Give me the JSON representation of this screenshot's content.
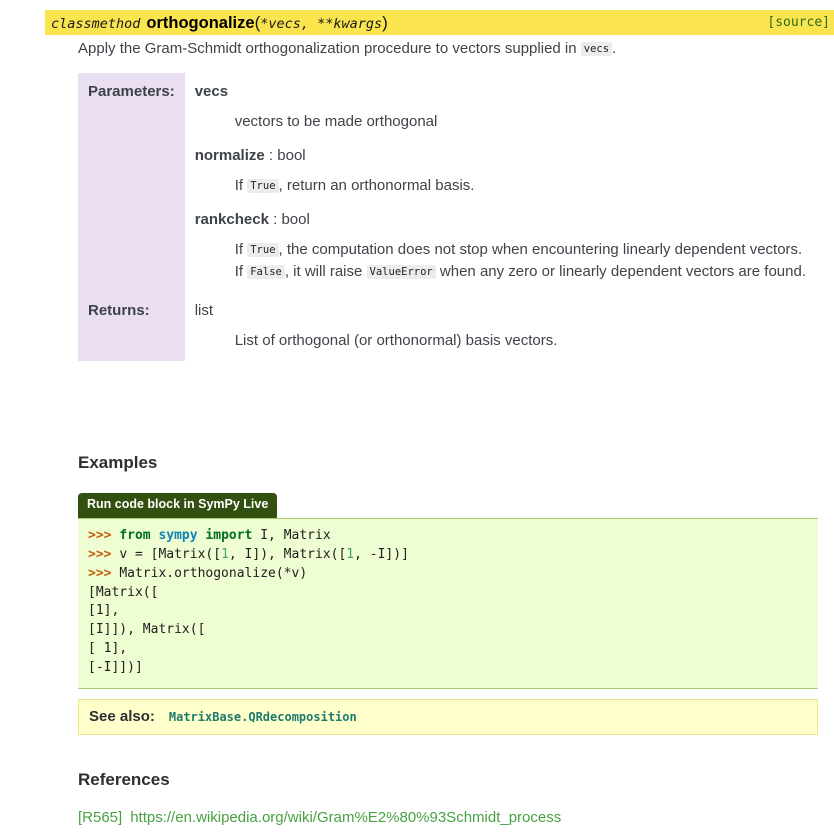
{
  "signature": {
    "prename": "classmethod",
    "name": "orthogonalize",
    "open_paren": "(",
    "params": "*vecs, **kwargs",
    "close_paren": ")",
    "source_link": "[source]",
    "background_color": "#fae54f",
    "source_link_color": "#2e6a1f"
  },
  "intro": {
    "text_before": "Apply the Gram-Schmidt orthogonalization procedure to vectors supplied in ",
    "inline_code": "vecs",
    "text_after": "."
  },
  "fields": [
    {
      "label": "Parameters:",
      "entries": [
        {
          "name": "vecs",
          "type": "",
          "separator": "",
          "description": "vectors to be made orthogonal"
        },
        {
          "name": "normalize",
          "separator": " : ",
          "type": "bool",
          "desc_prefix": "If ",
          "desc_code": "True",
          "desc_suffix": ", return an orthonormal basis."
        },
        {
          "name": "rankcheck",
          "separator": " : ",
          "type": "bool",
          "desc_line1_prefix": "If ",
          "desc_line1_code": "True",
          "desc_line1_suffix": ", the computation does not stop when encountering linearly dependent vectors.",
          "desc_line2_prefix": "If ",
          "desc_line2_code": "False",
          "desc_line2_mid": ", it will raise ",
          "desc_line2_code2": "ValueError",
          "desc_line2_suffix": " when any zero or linearly dependent vectors are found."
        }
      ]
    },
    {
      "label": "Returns:",
      "return_type": "list",
      "return_description": "List of orthogonal (or orthonormal) basis vectors."
    }
  ],
  "examples": {
    "heading": "Examples",
    "run_button_label": "Run code block in SymPy Live",
    "run_button_color": "#32500f",
    "code_background": "#effdd2",
    "lines": [
      {
        "tokens": [
          {
            "t": ">>> ",
            "c": "prompt"
          },
          {
            "t": "from ",
            "c": "kw"
          },
          {
            "t": "sympy ",
            "c": "mod"
          },
          {
            "t": "import ",
            "c": "kw"
          },
          {
            "t": "I, Matrix",
            "c": "plain"
          }
        ]
      },
      {
        "tokens": [
          {
            "t": ">>> ",
            "c": "prompt"
          },
          {
            "t": "v = [Matrix([",
            "c": "plain"
          },
          {
            "t": "1",
            "c": "num"
          },
          {
            "t": ", I]), Matrix([",
            "c": "plain"
          },
          {
            "t": "1",
            "c": "num"
          },
          {
            "t": ", -I])]",
            "c": "plain"
          }
        ]
      },
      {
        "tokens": [
          {
            "t": ">>> ",
            "c": "prompt"
          },
          {
            "t": "Matrix.orthogonalize(*v)",
            "c": "plain"
          }
        ]
      },
      {
        "tokens": [
          {
            "t": "[Matrix([",
            "c": "plain"
          }
        ]
      },
      {
        "tokens": [
          {
            "t": "[1],",
            "c": "plain"
          }
        ]
      },
      {
        "tokens": [
          {
            "t": "[I]]), Matrix([",
            "c": "plain"
          }
        ]
      },
      {
        "tokens": [
          {
            "t": "[ 1],",
            "c": "plain"
          }
        ]
      },
      {
        "tokens": [
          {
            "t": "[-I]])]",
            "c": "plain"
          }
        ]
      }
    ]
  },
  "see_also": {
    "title": "See also:",
    "link": "MatrixBase.QRdecomposition",
    "background_color": "#ffffcc",
    "link_color": "#1f7a6e"
  },
  "references": {
    "heading": "References",
    "label": "[R565]",
    "url": "https://en.wikipedia.org/wiki/Gram%E2%80%93Schmidt_process",
    "link_color": "#48a143"
  }
}
